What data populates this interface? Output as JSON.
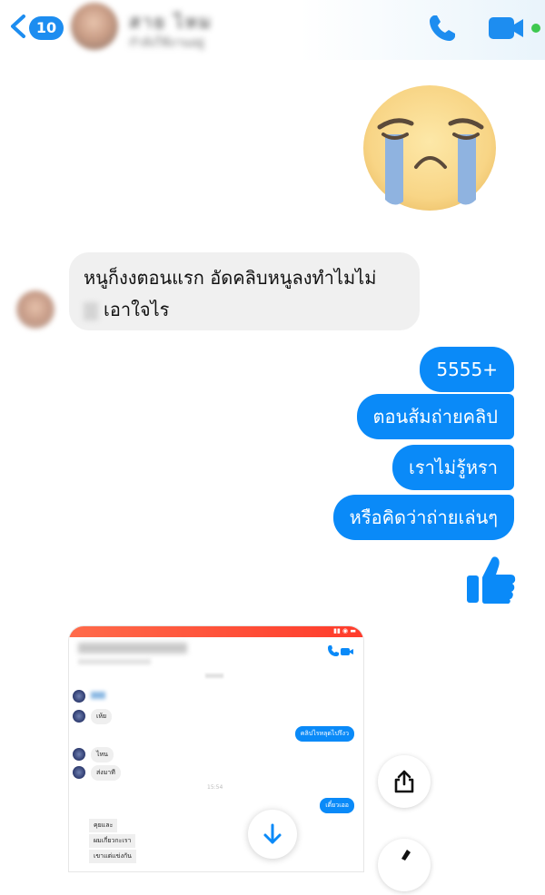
{
  "header": {
    "back_count": "10",
    "contact_name": "สาย ไหม",
    "contact_status": "กำลังใช้งานอยู่"
  },
  "emoji": {
    "big_sticker": "crying-face-icon",
    "thumbs_up": "thumbs-up-icon"
  },
  "messages": {
    "incoming": {
      "line1": "หนูก็งงตอนแรก อัดคลิบหนูลงทำไมไม่",
      "line2": "เอาใจไร"
    },
    "outgoing": [
      "5555+",
      "ตอนส้มถ่ายคลิป",
      "เราไม่รู้หรา",
      "หรือคิดว่าถ่ายเล่นๆ"
    ]
  },
  "shared_screenshot": {
    "incoming": [
      "เห้ย",
      "ไหน",
      "ส่งมาที"
    ],
    "outgoing": [
      "คลิปไรหลุดไปรึงว",
      "เดี๋ยวเออ"
    ],
    "group_lines": [
      "คุยและ",
      "ผมเกี่ยวกะเรา",
      "เขาแต่แข่งกัน"
    ],
    "time_stamp": "15:54"
  },
  "colors": {
    "accent": "#0a8af8",
    "badge": "#1d8df0",
    "online": "#3ec84f",
    "incoming_bg": "#f0f0f0"
  }
}
